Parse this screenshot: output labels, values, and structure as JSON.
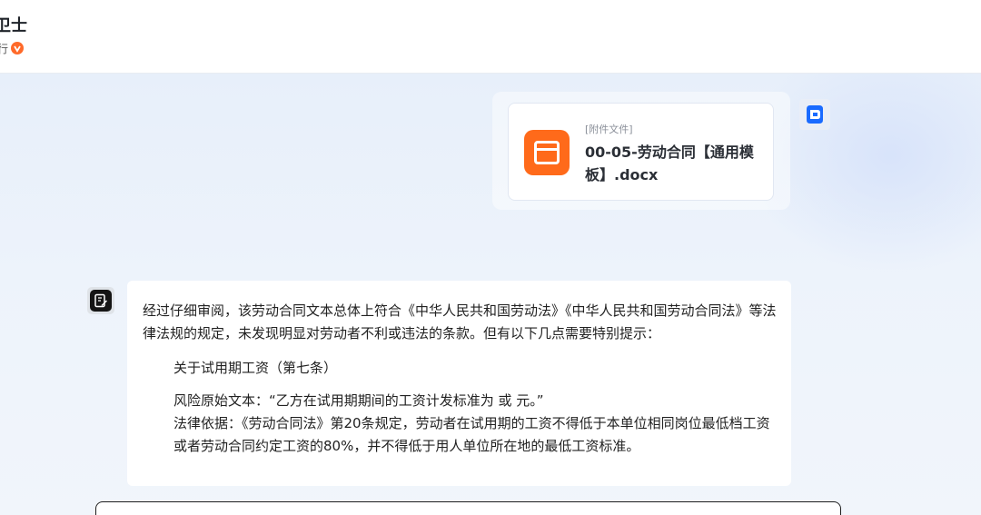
{
  "header": {
    "title": "卫士",
    "subtitle": "行",
    "verified_icon": "verified-badge-icon"
  },
  "user": {
    "avatar_icon": "user-avatar-icon"
  },
  "attachment": {
    "tag": "[附件文件]",
    "file_name": "00-05-劳动合同【通用模板】.docx",
    "icon": "folder-icon",
    "icon_color": "#ff6a1a"
  },
  "bot": {
    "avatar_icon": "document-edit-icon",
    "intro": "经过仔细审阅，该劳动合同文本总体上符合《中华人民共和国劳动法》《中华人民共和国劳动合同法》等法律法规的规定，未发现明显对劳动者不利或违法的条款。但有以下几点需要特别提示：",
    "item_title": "关于试用期工资（第七条）",
    "risk_text": "风险原始文本：“乙方在试用期期间的工资计发标准为 或 元。”",
    "law_text": "法律依据：《劳动合同法》第20条规定，劳动者在试用期的工资不得低于本单位相同岗位最低档工资或者劳动合同约定工资的80%，并不得低于用人单位所在地的最低工资标准。"
  },
  "input": {
    "placeholder": ""
  },
  "colors": {
    "accent": "#1a6bff",
    "file_icon": "#ff6a1a",
    "verified": "#ff6a2a"
  }
}
